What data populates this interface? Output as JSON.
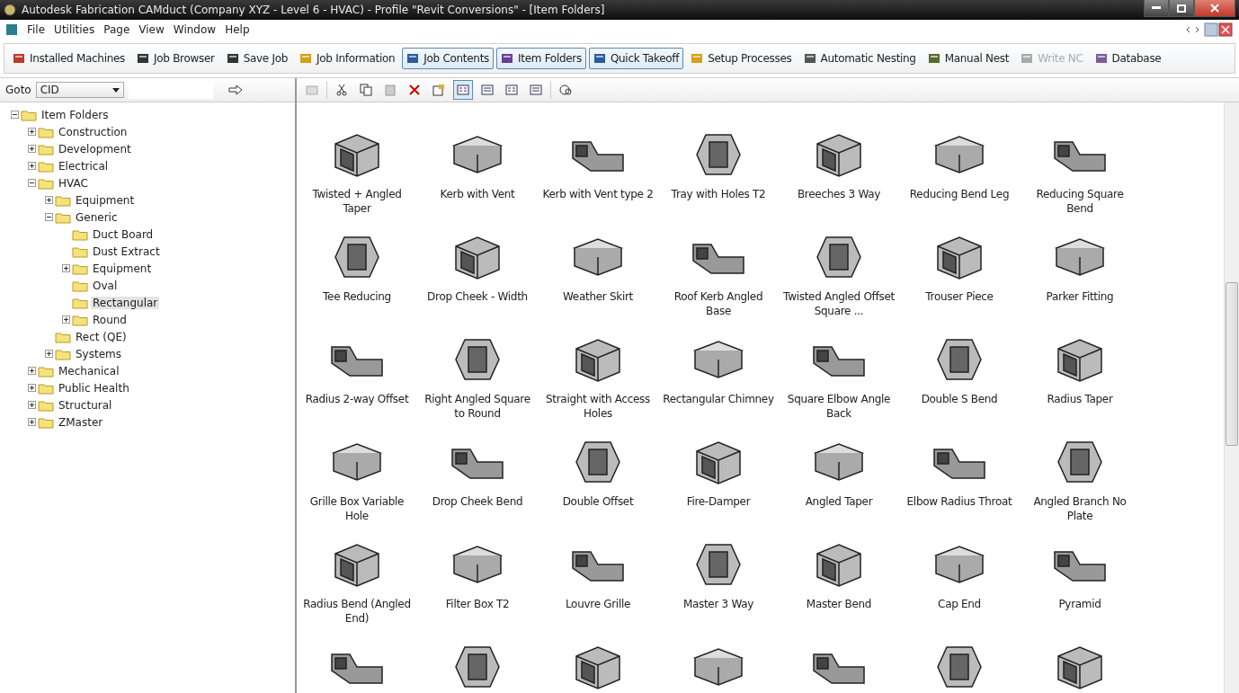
{
  "window": {
    "title": "Autodesk Fabrication CAMduct (Company XYZ - Level 6 - HVAC) - Profile \"Revit Conversions\" - [Item Folders]"
  },
  "menu": [
    "File",
    "Utilities",
    "Page",
    "View",
    "Window",
    "Help"
  ],
  "toolbar": [
    {
      "label": "Installed Machines",
      "pressed": false,
      "disabled": false
    },
    {
      "label": "Job Browser",
      "pressed": false,
      "disabled": false
    },
    {
      "label": "Save Job",
      "pressed": false,
      "disabled": false
    },
    {
      "label": "Job Information",
      "pressed": false,
      "disabled": false
    },
    {
      "label": "Job Contents",
      "pressed": true,
      "disabled": false
    },
    {
      "label": "Item Folders",
      "pressed": true,
      "disabled": false
    },
    {
      "label": "Quick Takeoff",
      "pressed": true,
      "disabled": false
    },
    {
      "label": "Setup Processes",
      "pressed": false,
      "disabled": false
    },
    {
      "label": "Automatic Nesting",
      "pressed": false,
      "disabled": false
    },
    {
      "label": "Manual Nest",
      "pressed": false,
      "disabled": false
    },
    {
      "label": "Write NC",
      "pressed": false,
      "disabled": true
    },
    {
      "label": "Database",
      "pressed": false,
      "disabled": false
    }
  ],
  "goto": {
    "label": "Goto",
    "value": "CID"
  },
  "view_modes": [
    {
      "selected": true
    },
    {
      "selected": false
    },
    {
      "selected": false
    },
    {
      "selected": false
    }
  ],
  "tree": [
    {
      "label": "Item Folders",
      "expanded": true,
      "selected": false,
      "children": [
        {
          "label": "Construction",
          "expanded": false,
          "selected": false
        },
        {
          "label": "Development",
          "expanded": false,
          "selected": false
        },
        {
          "label": "Electrical",
          "expanded": false,
          "selected": false
        },
        {
          "label": "HVAC",
          "expanded": true,
          "selected": false,
          "children": [
            {
              "label": "Equipment",
              "expanded": false,
              "selected": false
            },
            {
              "label": "Generic",
              "expanded": true,
              "selected": false,
              "children": [
                {
                  "label": "Duct Board",
                  "selected": false
                },
                {
                  "label": "Dust Extract",
                  "selected": false
                },
                {
                  "label": "Equipment",
                  "expanded": false,
                  "selected": false
                },
                {
                  "label": "Oval",
                  "selected": false
                },
                {
                  "label": "Rectangular",
                  "selected": true
                },
                {
                  "label": "Round",
                  "expanded": false,
                  "selected": false
                }
              ]
            },
            {
              "label": "Rect (QE)",
              "selected": false
            },
            {
              "label": "Systems",
              "expanded": false,
              "selected": false
            }
          ]
        },
        {
          "label": "Mechanical",
          "expanded": false,
          "selected": false
        },
        {
          "label": "Public Health",
          "expanded": false,
          "selected": false
        },
        {
          "label": "Structural",
          "expanded": false,
          "selected": false
        },
        {
          "label": "ZMaster",
          "expanded": false,
          "selected": false
        }
      ]
    }
  ],
  "items": [
    "Twisted + Angled Taper",
    "Kerb with Vent",
    "Kerb with Vent type 2",
    "Tray with Holes T2",
    "Breeches 3 Way",
    "Reducing Bend Leg",
    "Reducing Square Bend",
    "Tee Reducing",
    "Drop Cheek - Width",
    "Weather Skirt",
    "Roof Kerb Angled Base",
    "Twisted Angled Offset Square ...",
    "Trouser Piece",
    "Parker Fitting",
    "Radius 2-way Offset",
    "Right Angled Square to Round",
    "Straight with Access Holes",
    "Rectangular Chimney",
    "Square Elbow Angle Back",
    "Double S Bend",
    "Radius Taper",
    "Grille Box Variable Hole",
    "Drop Cheek Bend",
    "Double Offset",
    "Fire-Damper",
    "Angled Taper",
    "Elbow Radius Throat",
    "Angled Branch No Plate",
    "Radius Bend (Angled End)",
    "Filter Box T2",
    "Louvre Grille",
    "Master 3 Way",
    "Master Bend",
    "Cap End",
    "Pyramid"
  ]
}
